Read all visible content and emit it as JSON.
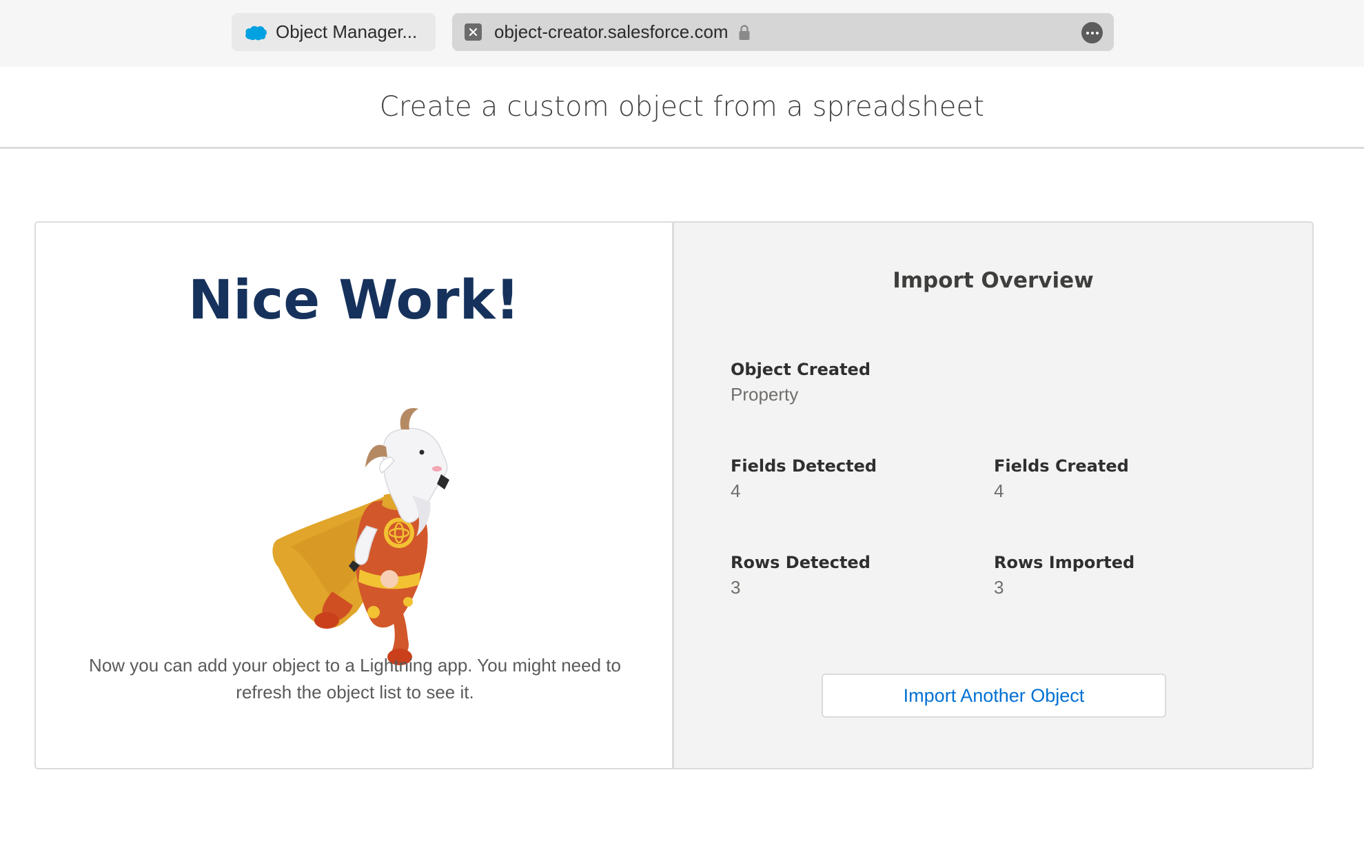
{
  "browser": {
    "tab_label": "Object Manager...",
    "url": "object-creator.salesforce.com",
    "tab_icon": "salesforce-cloud-icon",
    "brand_color": "#00a1e0"
  },
  "header": {
    "title": "Create a custom object from a spreadsheet"
  },
  "success_panel": {
    "heading": "Nice Work!",
    "illustration": "astro-goat-mascot",
    "message": "Now you can add your object to a Lightning app. You might need to refresh the object list to see it."
  },
  "overview": {
    "title": "Import Overview",
    "object_created": {
      "label": "Object Created",
      "value": "Property"
    },
    "fields_detected": {
      "label": "Fields Detected",
      "value": "4"
    },
    "fields_created": {
      "label": "Fields Created",
      "value": "4"
    },
    "rows_detected": {
      "label": "Rows Detected",
      "value": "3"
    },
    "rows_imported": {
      "label": "Rows Imported",
      "value": "3"
    },
    "action_button": "Import Another Object"
  },
  "colors": {
    "heading": "#16325c",
    "link": "#0070d2",
    "panel_bg": "#f3f3f3"
  }
}
